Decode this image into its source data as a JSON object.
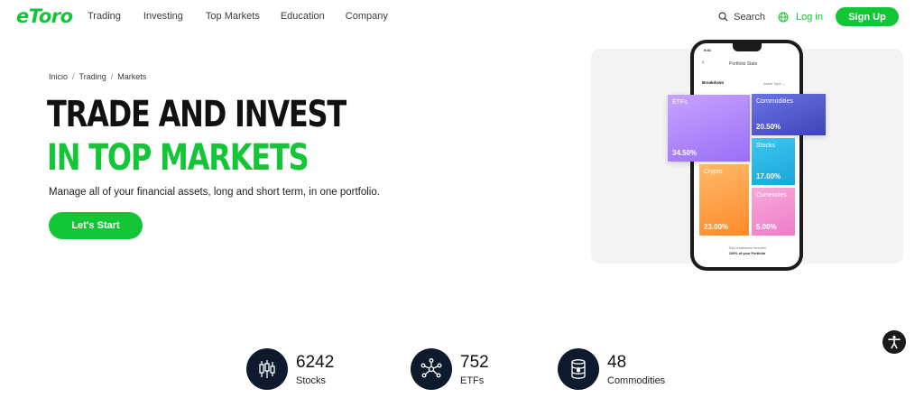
{
  "nav": {
    "logo": "eToro",
    "links": [
      "Trading",
      "Investing",
      "Top Markets",
      "Education",
      "Company"
    ],
    "search_label": "Search",
    "login_label": "Log in",
    "signup_label": "Sign Up"
  },
  "breadcrumb": [
    "Inicio",
    "Trading",
    "Markets"
  ],
  "hero": {
    "title_line1": "TRADE AND INVEST",
    "title_line2": "IN TOP MARKETS",
    "subtitle": "Manage all of your financial assets, long and short term, in one portfolio.",
    "cta_label": "Let's Start"
  },
  "phone": {
    "time": "9:41",
    "back_icon": "chevron-left-icon",
    "title": "Portfolio Stats",
    "breakdown_label": "Breakdown",
    "asset_type_label": "Asset Type ⌄",
    "tiles": {
      "etfs": {
        "name": "ETFs",
        "value": "34.50%"
      },
      "commodities": {
        "name": "Commodities",
        "value": "20.50%"
      },
      "stocks": {
        "name": "Stocks",
        "value": "17.00%"
      },
      "crypto": {
        "name": "Crypto",
        "value": "23.00%"
      },
      "currencies": {
        "name": "Currencies",
        "value": "5.00%"
      }
    },
    "footer_line1": "This breakdown includes",
    "footer_line2": "100% of your Portfolio"
  },
  "stats": [
    {
      "number": "6242",
      "label": "Stocks",
      "icon": "candlestick-icon"
    },
    {
      "number": "752",
      "label": "ETFs",
      "icon": "network-icon"
    },
    {
      "number": "48",
      "label": "Commodities",
      "icon": "oil-barrel-icon"
    }
  ],
  "colors": {
    "brand_green": "#13c636",
    "dark_navy": "#0e1a2e"
  }
}
